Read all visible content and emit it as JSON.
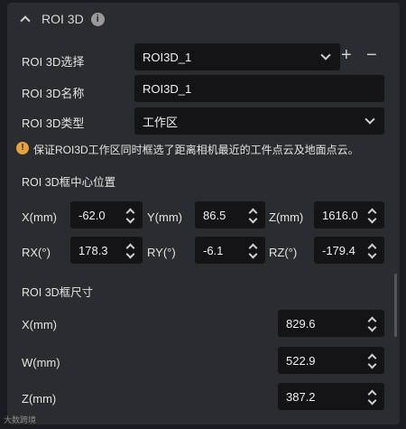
{
  "header": {
    "title": "ROI 3D",
    "info_icon": "info-icon"
  },
  "roi_select": {
    "label": "ROI 3D选择",
    "value": "ROI3D_1",
    "add": "+",
    "remove": "−"
  },
  "roi_name": {
    "label": "ROI 3D名称",
    "value": "ROI3D_1"
  },
  "roi_type": {
    "label": "ROI 3D类型",
    "value": "工作区"
  },
  "warning": {
    "icon": "warning-icon",
    "text": "保证ROI3D工作区同时框选了距离相机最近的工件点云及地面点云。",
    "color": "#e6a23c"
  },
  "center": {
    "title": "ROI 3D框中心位置",
    "x": {
      "label": "X(mm)",
      "value": "-62.0"
    },
    "y": {
      "label": "Y(mm)",
      "value": "86.5"
    },
    "z": {
      "label": "Z(mm)",
      "value": "1616.0"
    },
    "rx": {
      "label": "RX(°)",
      "value": "178.3"
    },
    "ry": {
      "label": "RY(°)",
      "value": "-6.1"
    },
    "rz": {
      "label": "RZ(°)",
      "value": "-179.4"
    }
  },
  "size": {
    "title": "ROI 3D框尺寸",
    "x": {
      "label": "X(mm)",
      "value": "829.6"
    },
    "w": {
      "label": "W(mm)",
      "value": "522.9"
    },
    "z": {
      "label": "Z(mm)",
      "value": "387.2"
    }
  },
  "watermark": "大数跨境"
}
